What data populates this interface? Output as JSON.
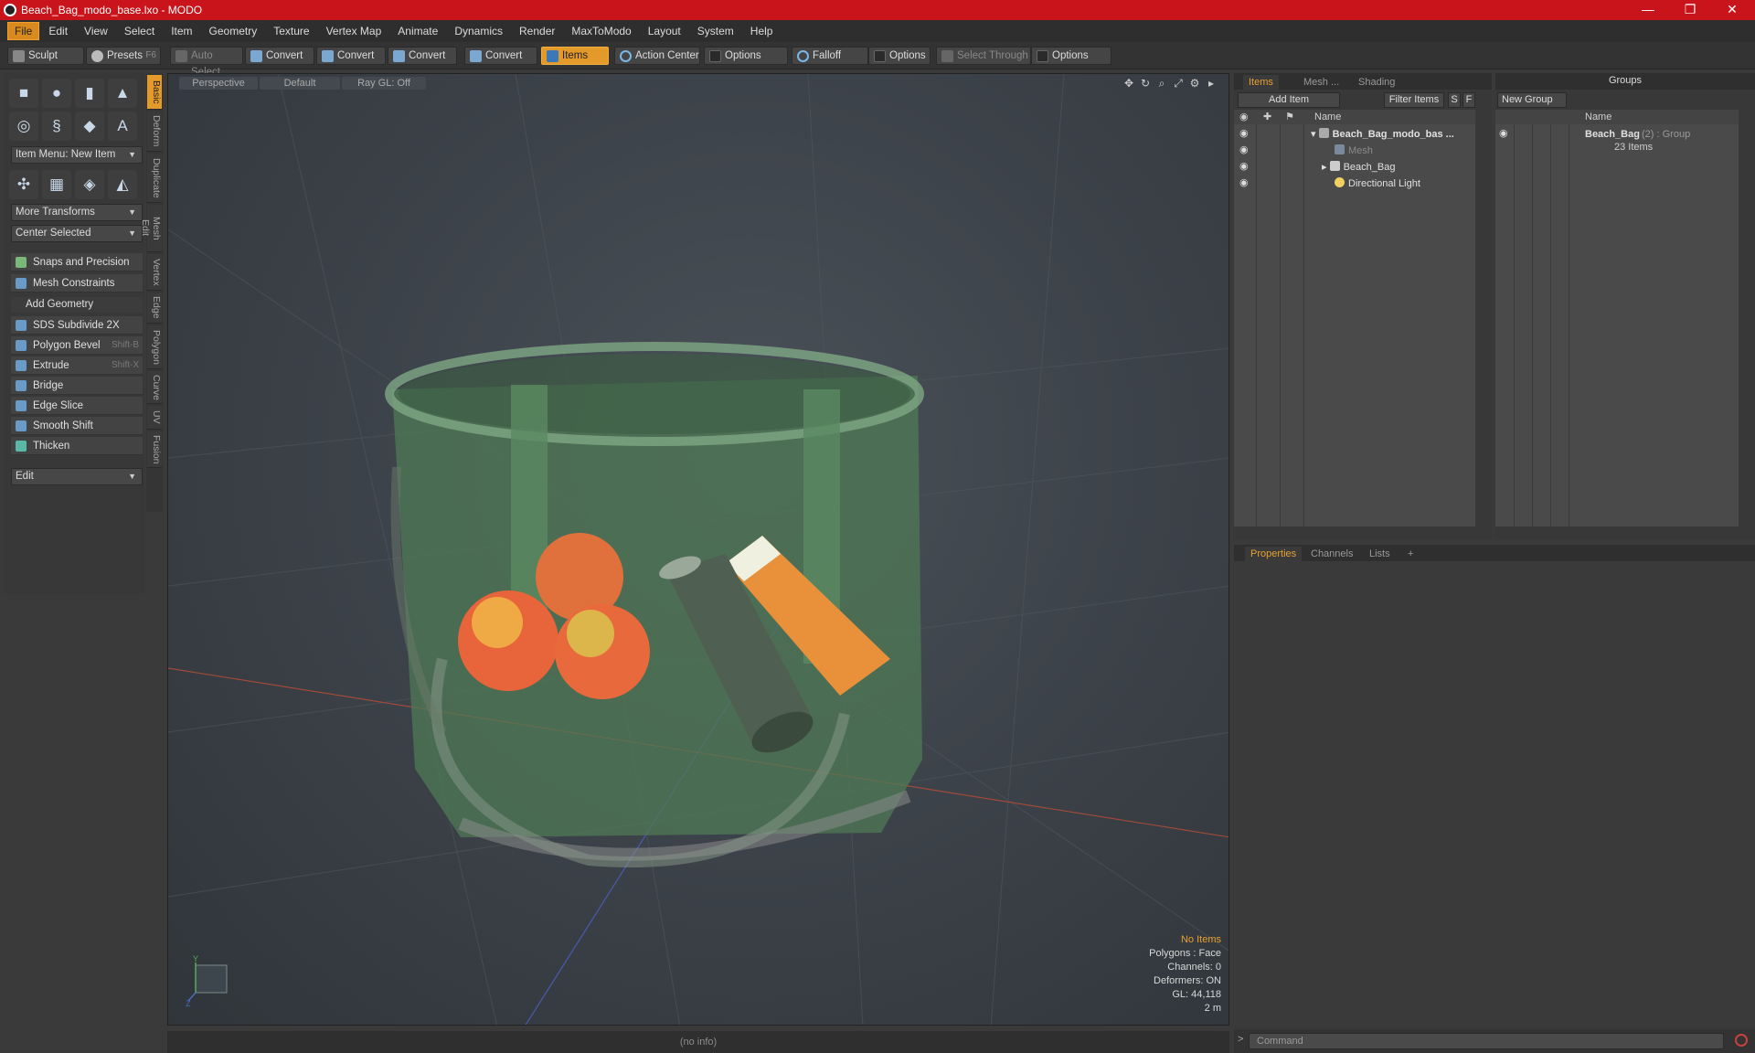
{
  "window": {
    "title": "Beach_Bag_modo_base.lxo - MODO",
    "controls": [
      "—",
      "❐",
      "✕"
    ]
  },
  "menubar": {
    "items": [
      "File",
      "Edit",
      "View",
      "Select",
      "Item",
      "Geometry",
      "Texture",
      "Vertex Map",
      "Animate",
      "Dynamics",
      "Render",
      "MaxToModo",
      "Layout",
      "System",
      "Help"
    ]
  },
  "toolbar": {
    "sculpt": "Sculpt",
    "presets": "Presets",
    "presets_key": "F6",
    "auto_select": "Auto Select",
    "convert1": "Convert",
    "convert2": "Convert",
    "convert3": "Convert",
    "convert4": "Convert",
    "items": "Items",
    "action_center": "Action Center",
    "options1": "Options",
    "falloff": "Falloff",
    "options2": "Options",
    "select_through": "Select Through",
    "options3": "Options"
  },
  "leftpanel": {
    "item_menu": "Item Menu: New Item",
    "more_transforms": "More Transforms",
    "center_selected": "Center Selected",
    "snaps": "Snaps and Precision",
    "mesh_constraints": "Mesh Constraints",
    "add_geometry": "Add Geometry",
    "tools": [
      {
        "label": "SDS Subdivide 2X",
        "key": ""
      },
      {
        "label": "Polygon Bevel",
        "key": "Shift-B"
      },
      {
        "label": "Extrude",
        "key": "Shift-X"
      },
      {
        "label": "Bridge",
        "key": ""
      },
      {
        "label": "Edge Slice",
        "key": ""
      },
      {
        "label": "Smooth Shift",
        "key": ""
      },
      {
        "label": "Thicken",
        "key": ""
      }
    ],
    "edit": "Edit",
    "vtabs": [
      "Basic",
      "Deform",
      "Duplicate",
      "Mesh Edit",
      "Vertex",
      "Edge",
      "Polygon",
      "Curve",
      "UV",
      "Fusion"
    ]
  },
  "viewport": {
    "view": "Perspective",
    "style": "Default",
    "raygl": "Ray GL: Off",
    "info": {
      "selection": "No Items",
      "polygons": "Polygons : Face",
      "channels": "Channels: 0",
      "deformers": "Deformers: ON",
      "gl": "GL: 44,118",
      "scale": "2 m"
    },
    "axis_y": "Y",
    "axis_z": "Z"
  },
  "statusbar": {
    "text": "(no info)"
  },
  "itemspanel": {
    "tabs": [
      "Items",
      "Mesh ...",
      "Shading"
    ],
    "add_item": "Add Item",
    "filter_items": "Filter Items",
    "s": "S",
    "f": "F",
    "col_name": "Name",
    "rows": [
      {
        "label": "Beach_Bag_modo_bas ...",
        "bold": true
      },
      {
        "label": "Mesh",
        "dim": true
      },
      {
        "label": "Beach_Bag"
      },
      {
        "label": "Directional Light"
      }
    ]
  },
  "groupspanel": {
    "title": "Groups",
    "new_group": "New Group",
    "col_name": "Name",
    "group_name": "Beach_Bag",
    "group_meta": "(2) : Group",
    "group_count": "23 Items"
  },
  "proppanel": {
    "tabs": [
      "Properties",
      "Channels",
      "Lists"
    ],
    "add": "+"
  },
  "command": {
    "placeholder": "Command"
  },
  "colors": {
    "accent": "#e39a2a",
    "titlebar": "#c8141a",
    "selection_text": "#e8a030"
  }
}
